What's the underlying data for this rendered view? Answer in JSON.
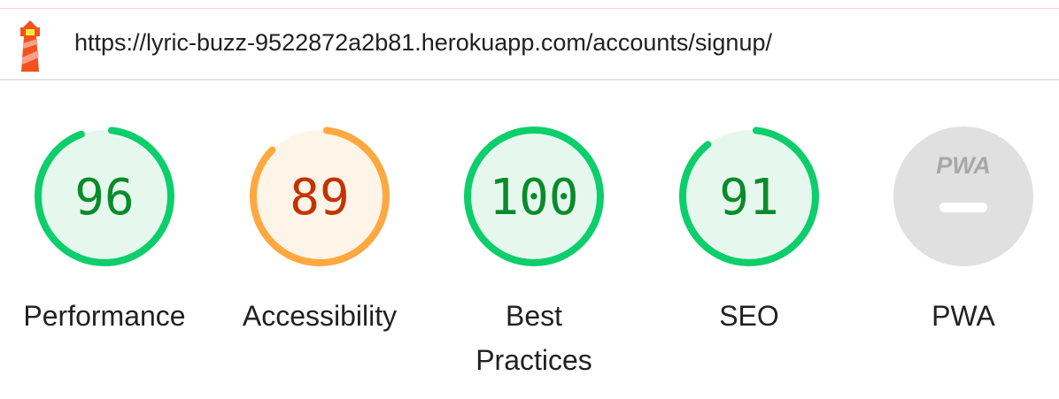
{
  "header": {
    "url": "https://lyric-buzz-9522872a2b81.herokuapp.com/accounts/signup/",
    "logo_icon": "lighthouse-icon"
  },
  "gauges": [
    {
      "label": "Performance",
      "score": 96,
      "status": "pass"
    },
    {
      "label": "Accessibility",
      "score": 89,
      "status": "average"
    },
    {
      "label": "Best Practices",
      "score": 100,
      "status": "pass"
    },
    {
      "label": "SEO",
      "score": 91,
      "status": "pass"
    }
  ],
  "pwa": {
    "label": "PWA",
    "badge_text": "PWA",
    "icon": "pwa-badge-icon"
  },
  "colors": {
    "pass_ring": "#0cce6b",
    "pass_fill": "#e6f8ee",
    "pass_text": "#0a8b2b",
    "average_ring": "#ffa83f",
    "average_fill": "#fff4e8",
    "average_text": "#c33300",
    "pwa_fill": "#e0e0e0",
    "pwa_text": "#a8a8a8"
  }
}
